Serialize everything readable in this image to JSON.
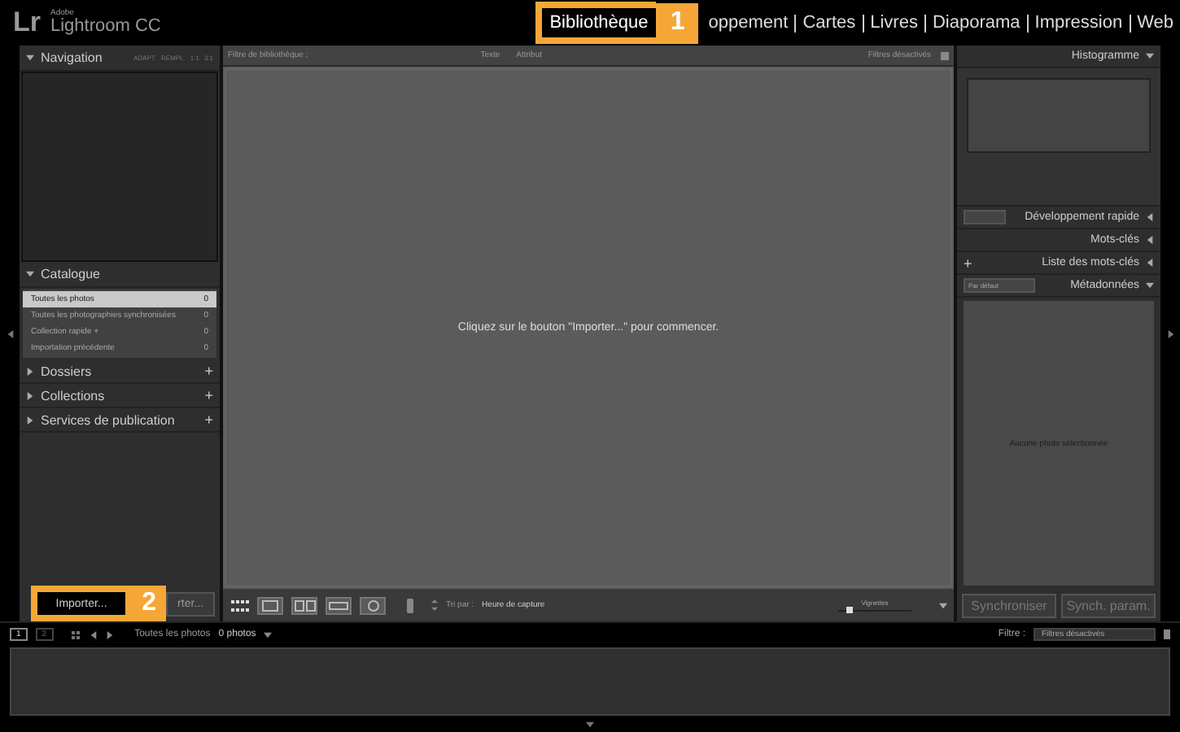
{
  "app": {
    "vendor": "Adobe",
    "name": "Lightroom CC",
    "logo": "Lr"
  },
  "modules": [
    {
      "label": "Bibliothèque",
      "selected": true
    },
    {
      "label": "oppement",
      "selected": false
    },
    {
      "label": "Cartes",
      "selected": false
    },
    {
      "label": "Livres",
      "selected": false
    },
    {
      "label": "Diaporama",
      "selected": false
    },
    {
      "label": "Impression",
      "selected": false
    },
    {
      "label": "Web",
      "selected": false
    }
  ],
  "callouts": [
    {
      "number": "1"
    },
    {
      "number": "2"
    }
  ],
  "left_panel": {
    "navigation": {
      "title": "Navigation",
      "zoom_options": [
        "ADAPT.",
        "REMPL.",
        "1:1",
        "3:1"
      ]
    },
    "catalogue": {
      "title": "Catalogue",
      "items": [
        {
          "label": "Toutes les photos",
          "count": "0",
          "selected": true
        },
        {
          "label": "Toutes les photographies synchronisées",
          "count": "0",
          "selected": false
        },
        {
          "label": "Collection rapide +",
          "count": "0",
          "selected": false
        },
        {
          "label": "Importation précédente",
          "count": "0",
          "selected": false
        }
      ]
    },
    "sections": [
      {
        "title": "Dossiers",
        "action": "+"
      },
      {
        "title": "Collections",
        "action": "+"
      },
      {
        "title": "Services de publication",
        "action": "+"
      }
    ],
    "buttons": [
      "Importer...",
      "rter..."
    ]
  },
  "filter_bar": {
    "title": "Filtre de bibliothèque :",
    "options": [
      "Texte",
      "Attribut"
    ],
    "state": "Filtres désactivés"
  },
  "center": {
    "message": "Cliquez sur le bouton \"Importer...\" pour commencer."
  },
  "toolbar": {
    "sort_label": "Tri par :",
    "sort_value": "Heure de capture",
    "thumbnail": {
      "label": "Vignettes",
      "level": 0.15
    }
  },
  "right_panel": {
    "histogram": {
      "title": "Histogramme"
    },
    "sections": [
      {
        "title": "Développement rapide",
        "kind": "preset"
      },
      {
        "title": "Mots-clés",
        "kind": "plain"
      },
      {
        "title": "Liste des mots-clés",
        "kind": "add",
        "action": "+"
      },
      {
        "title": "Métadonnées",
        "kind": "dropdown",
        "value": "Par défaut"
      }
    ],
    "empty_message": "Aucune photo sélectionnée",
    "buttons": [
      "Synchroniser",
      "Synch. param."
    ]
  },
  "filmstrip": {
    "pages": [
      {
        "label": "1",
        "selected": true
      },
      {
        "label": "2",
        "selected": false
      }
    ],
    "source": "Toutes les photos",
    "count": "0 photos",
    "filter_label": "Filtre :",
    "filter_value": "Filtres désactivés"
  }
}
